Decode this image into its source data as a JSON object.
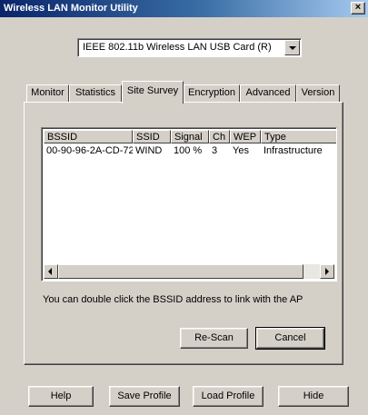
{
  "window": {
    "title": "Wireless LAN Monitor Utility",
    "close_glyph": "×"
  },
  "card_select": {
    "value": "IEEE 802.11b Wireless LAN USB Card (R)",
    "arrow_icon": "chevron-down-icon"
  },
  "tabs": [
    {
      "label": "Monitor",
      "active": false
    },
    {
      "label": "Statistics",
      "active": false
    },
    {
      "label": "Site Survey",
      "active": true
    },
    {
      "label": "Encryption",
      "active": false
    },
    {
      "label": "Advanced",
      "active": false
    },
    {
      "label": "Version",
      "active": false
    }
  ],
  "site_survey": {
    "columns": [
      "BSSID",
      "SSID",
      "Signal",
      "Ch",
      "WEP",
      "Type"
    ],
    "rows": [
      [
        "00-90-96-2A-CD-72",
        "WIND",
        "100 %",
        "3",
        "Yes",
        "Infrastructure"
      ]
    ],
    "hint": "You can double click the BSSID address to link with the AP",
    "rescan_label": "Re-Scan",
    "cancel_label": "Cancel"
  },
  "footer": {
    "help_label": "Help",
    "save_profile_label": "Save Profile",
    "load_profile_label": "Load Profile",
    "hide_label": "Hide"
  },
  "colors": {
    "face": "#d4d0c8",
    "title_start": "#0a246a",
    "title_end": "#a6caf0"
  }
}
